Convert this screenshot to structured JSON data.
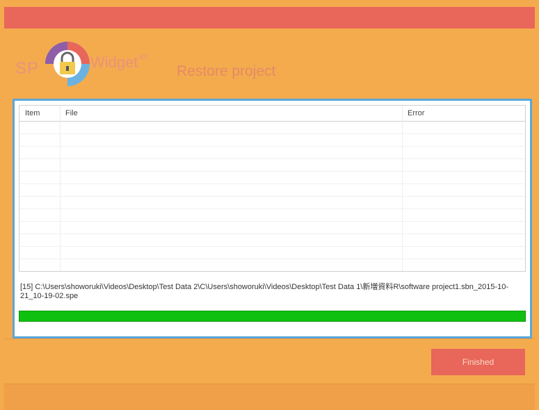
{
  "brand": {
    "left_text": "SP",
    "right_text": "Widget",
    "superscript": "Kit",
    "icon": "padlock-icon"
  },
  "header": {
    "title": "Restore project"
  },
  "table": {
    "columns": [
      "Item",
      "File",
      "Error"
    ],
    "rows": []
  },
  "status": {
    "path_text": "[15] C:\\Users\\showoruki\\Videos\\Desktop\\Test Data 2\\C\\Users\\showoruki\\Videos\\Desktop\\Test Data 1\\新増資料R\\software project1.sbn_2015-10-21_10-19-02.spe"
  },
  "progress": {
    "percent": 100,
    "color": "#10c010"
  },
  "buttons": {
    "finished": "Finished"
  },
  "colors": {
    "titlebar": "#e8665a",
    "background": "#f4ab4e",
    "panel_border": "#5aa7d8",
    "button": "#e8665a"
  }
}
